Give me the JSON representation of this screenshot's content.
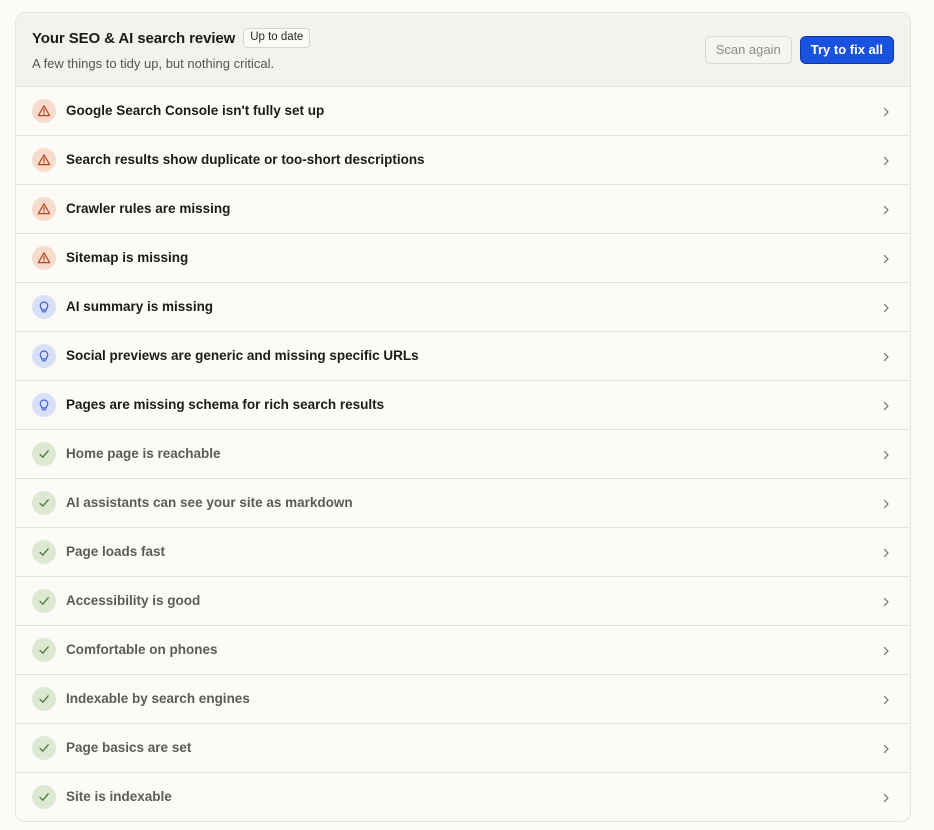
{
  "header": {
    "title": "Your SEO & AI search review",
    "status_badge": "Up to date",
    "subtitle": "A few things to tidy up, but nothing critical.",
    "scan_again_label": "Scan again",
    "fix_all_label": "Try to fix all"
  },
  "colors": {
    "primary_button": "#1a52e0",
    "warning_bg": "#f6dccd",
    "warning_fg": "#b8441e",
    "info_bg": "#d8e0f7",
    "info_fg": "#3a5fd0",
    "pass_bg": "#dce8d2",
    "pass_fg": "#4d7a3a"
  },
  "checks": [
    {
      "label": "Google Search Console isn't fully set up",
      "severity": "warning",
      "icon": "warning-triangle-icon"
    },
    {
      "label": "Search results show duplicate or too-short descriptions",
      "severity": "warning",
      "icon": "warning-triangle-icon"
    },
    {
      "label": "Crawler rules are missing",
      "severity": "warning",
      "icon": "warning-triangle-icon"
    },
    {
      "label": "Sitemap is missing",
      "severity": "warning",
      "icon": "warning-triangle-icon"
    },
    {
      "label": "AI summary is missing",
      "severity": "info",
      "icon": "lightbulb-icon"
    },
    {
      "label": "Social previews are generic and missing specific URLs",
      "severity": "info",
      "icon": "lightbulb-icon"
    },
    {
      "label": "Pages are missing schema for rich search results",
      "severity": "info",
      "icon": "lightbulb-icon"
    },
    {
      "label": "Home page is reachable",
      "severity": "pass",
      "icon": "checkmark-icon"
    },
    {
      "label": "AI assistants can see your site as markdown",
      "severity": "pass",
      "icon": "checkmark-icon"
    },
    {
      "label": "Page loads fast",
      "severity": "pass",
      "icon": "checkmark-icon"
    },
    {
      "label": "Accessibility is good",
      "severity": "pass",
      "icon": "checkmark-icon"
    },
    {
      "label": "Comfortable on phones",
      "severity": "pass",
      "icon": "checkmark-icon"
    },
    {
      "label": "Indexable by search engines",
      "severity": "pass",
      "icon": "checkmark-icon"
    },
    {
      "label": "Page basics are set",
      "severity": "pass",
      "icon": "checkmark-icon"
    },
    {
      "label": "Site is indexable",
      "severity": "pass",
      "icon": "checkmark-icon"
    }
  ]
}
